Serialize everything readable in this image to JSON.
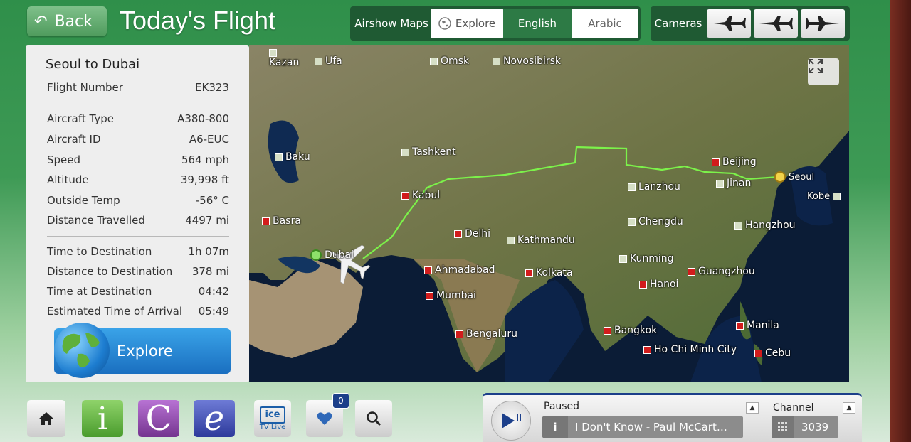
{
  "header": {
    "back_label": "Back",
    "title": "Today's Flight",
    "airshow_label": "Airshow Maps",
    "tabs": [
      {
        "label": "Explore",
        "icon": "globe-icon"
      },
      {
        "label": "English"
      },
      {
        "label": "Arabic"
      }
    ],
    "cameras_label": "Cameras",
    "camera_icons": [
      "plane-front-icon",
      "plane-side-icon",
      "plane-side-icon"
    ]
  },
  "flight": {
    "route": "Seoul to Dubai",
    "number_label": "Flight Number",
    "number": "EK323",
    "aircraft_type_label": "Aircraft Type",
    "aircraft_type": "A380-800",
    "aircraft_id_label": "Aircraft ID",
    "aircraft_id": "A6-EUC",
    "speed_label": "Speed",
    "speed": "564 mph",
    "altitude_label": "Altitude",
    "altitude": "39,998 ft",
    "outside_temp_label": "Outside Temp",
    "outside_temp": "-56° C",
    "distance_travelled_label": "Distance Travelled",
    "distance_travelled": "4497 mi",
    "time_to_dest_label": "Time to Destination",
    "time_to_dest": "1h 07m",
    "distance_to_dest_label": "Distance to Destination",
    "distance_to_dest": "378 mi",
    "time_at_dest_label": "Time at Destination",
    "time_at_dest": "04:42",
    "eta_label": "Estimated Time of Arrival",
    "eta": "05:49",
    "explore_button": "Explore"
  },
  "map": {
    "cities": [
      {
        "name": "Kazan",
        "type": "grey"
      },
      {
        "name": "Ufa",
        "type": "grey"
      },
      {
        "name": "Omsk",
        "type": "grey"
      },
      {
        "name": "Novosibirsk",
        "type": "grey"
      },
      {
        "name": "Baku",
        "type": "grey"
      },
      {
        "name": "Tashkent",
        "type": "grey"
      },
      {
        "name": "Kabul",
        "type": "red"
      },
      {
        "name": "Basra",
        "type": "red"
      },
      {
        "name": "Dubai",
        "type": "dest"
      },
      {
        "name": "Delhi",
        "type": "red"
      },
      {
        "name": "Kathmandu",
        "type": "grey"
      },
      {
        "name": "Ahmadabad",
        "type": "red"
      },
      {
        "name": "Mumbai",
        "type": "red"
      },
      {
        "name": "Bengaluru",
        "type": "red"
      },
      {
        "name": "Kolkata",
        "type": "red"
      },
      {
        "name": "Beijing",
        "type": "red"
      },
      {
        "name": "Jinan",
        "type": "grey"
      },
      {
        "name": "Seoul",
        "type": "origin"
      },
      {
        "name": "Kobe",
        "type": "grey"
      },
      {
        "name": "Lanzhou",
        "type": "grey"
      },
      {
        "name": "Chengdu",
        "type": "grey"
      },
      {
        "name": "Hangzhou",
        "type": "grey"
      },
      {
        "name": "Kunming",
        "type": "grey"
      },
      {
        "name": "Guangzhou",
        "type": "red"
      },
      {
        "name": "Hanoi",
        "type": "red"
      },
      {
        "name": "Bangkok",
        "type": "red"
      },
      {
        "name": "Ho Chi Minh City",
        "type": "red"
      },
      {
        "name": "Manila",
        "type": "red"
      },
      {
        "name": "Cebu",
        "type": "red"
      }
    ],
    "route_color": "#7cf24a",
    "fullscreen_icon": "fullscreen-icon"
  },
  "bottom": {
    "favorites_count": "0",
    "tv_label": "TV Live",
    "ice_label": "ice",
    "info_label": "i",
    "c_label": "C",
    "e_label": "e",
    "player_status": "Paused",
    "track": "I Don't Know - Paul McCart…",
    "channel_label": "Channel",
    "channel": "3039"
  }
}
